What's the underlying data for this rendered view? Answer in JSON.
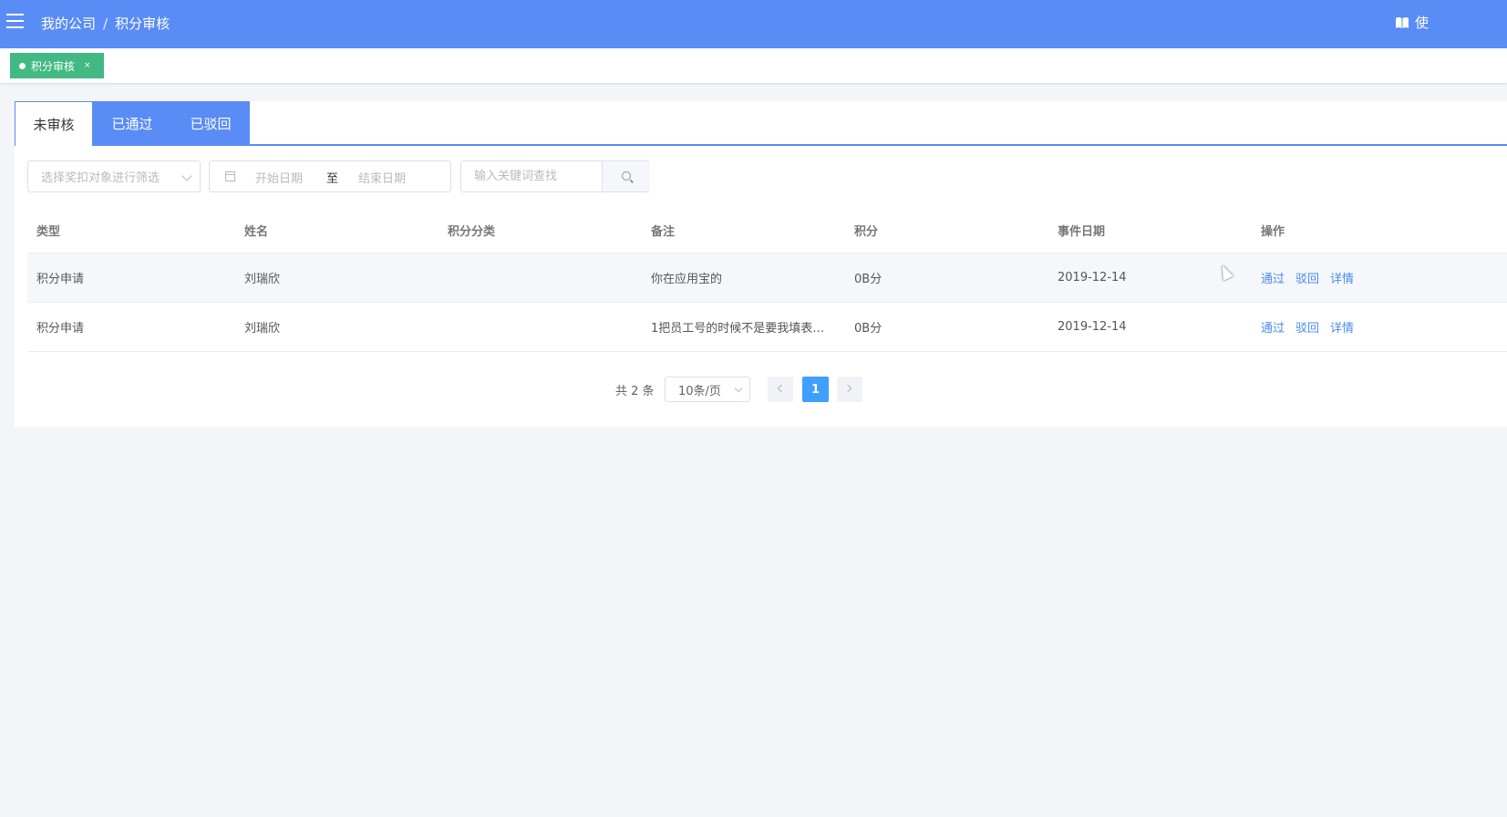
{
  "header": {
    "breadcrumb": [
      "我的公司",
      "积分审核"
    ],
    "separator": "/",
    "manual_label": "使"
  },
  "tagsbar": {
    "tag_label": "积分审核",
    "tag_close": "×"
  },
  "tabs": [
    {
      "label": "未审核",
      "active": true
    },
    {
      "label": "已通过",
      "active": false
    },
    {
      "label": "已驳回",
      "active": false
    }
  ],
  "filters": {
    "target_placeholder": "选择奖扣对象进行筛选",
    "start_placeholder": "开始日期",
    "range_sep": "至",
    "end_placeholder": "结束日期",
    "keyword_placeholder": "输入关键词查找"
  },
  "table": {
    "columns": [
      "类型",
      "姓名",
      "积分分类",
      "备注",
      "积分",
      "事件日期",
      "操作"
    ],
    "rows": [
      {
        "type": "积分申请",
        "name": "刘瑞欣",
        "category": "",
        "remark": "你在应用宝的",
        "points": "0B分",
        "date": "2019-12-14"
      },
      {
        "type": "积分申请",
        "name": "刘瑞欣",
        "category": "",
        "remark": "1把员工号的时候不是要我填表…",
        "points": "0B分",
        "date": "2019-12-14"
      }
    ],
    "actions": {
      "approve": "通过",
      "reject": "驳回",
      "detail": "详情"
    }
  },
  "pagination": {
    "total": "共 2 条",
    "page_size": "10条/页",
    "current_page": "1"
  },
  "colors": {
    "header_bg": "#5a8cf5",
    "tag_bg": "#42b983",
    "link": "#4a8bf0",
    "page_active": "#409eff"
  }
}
